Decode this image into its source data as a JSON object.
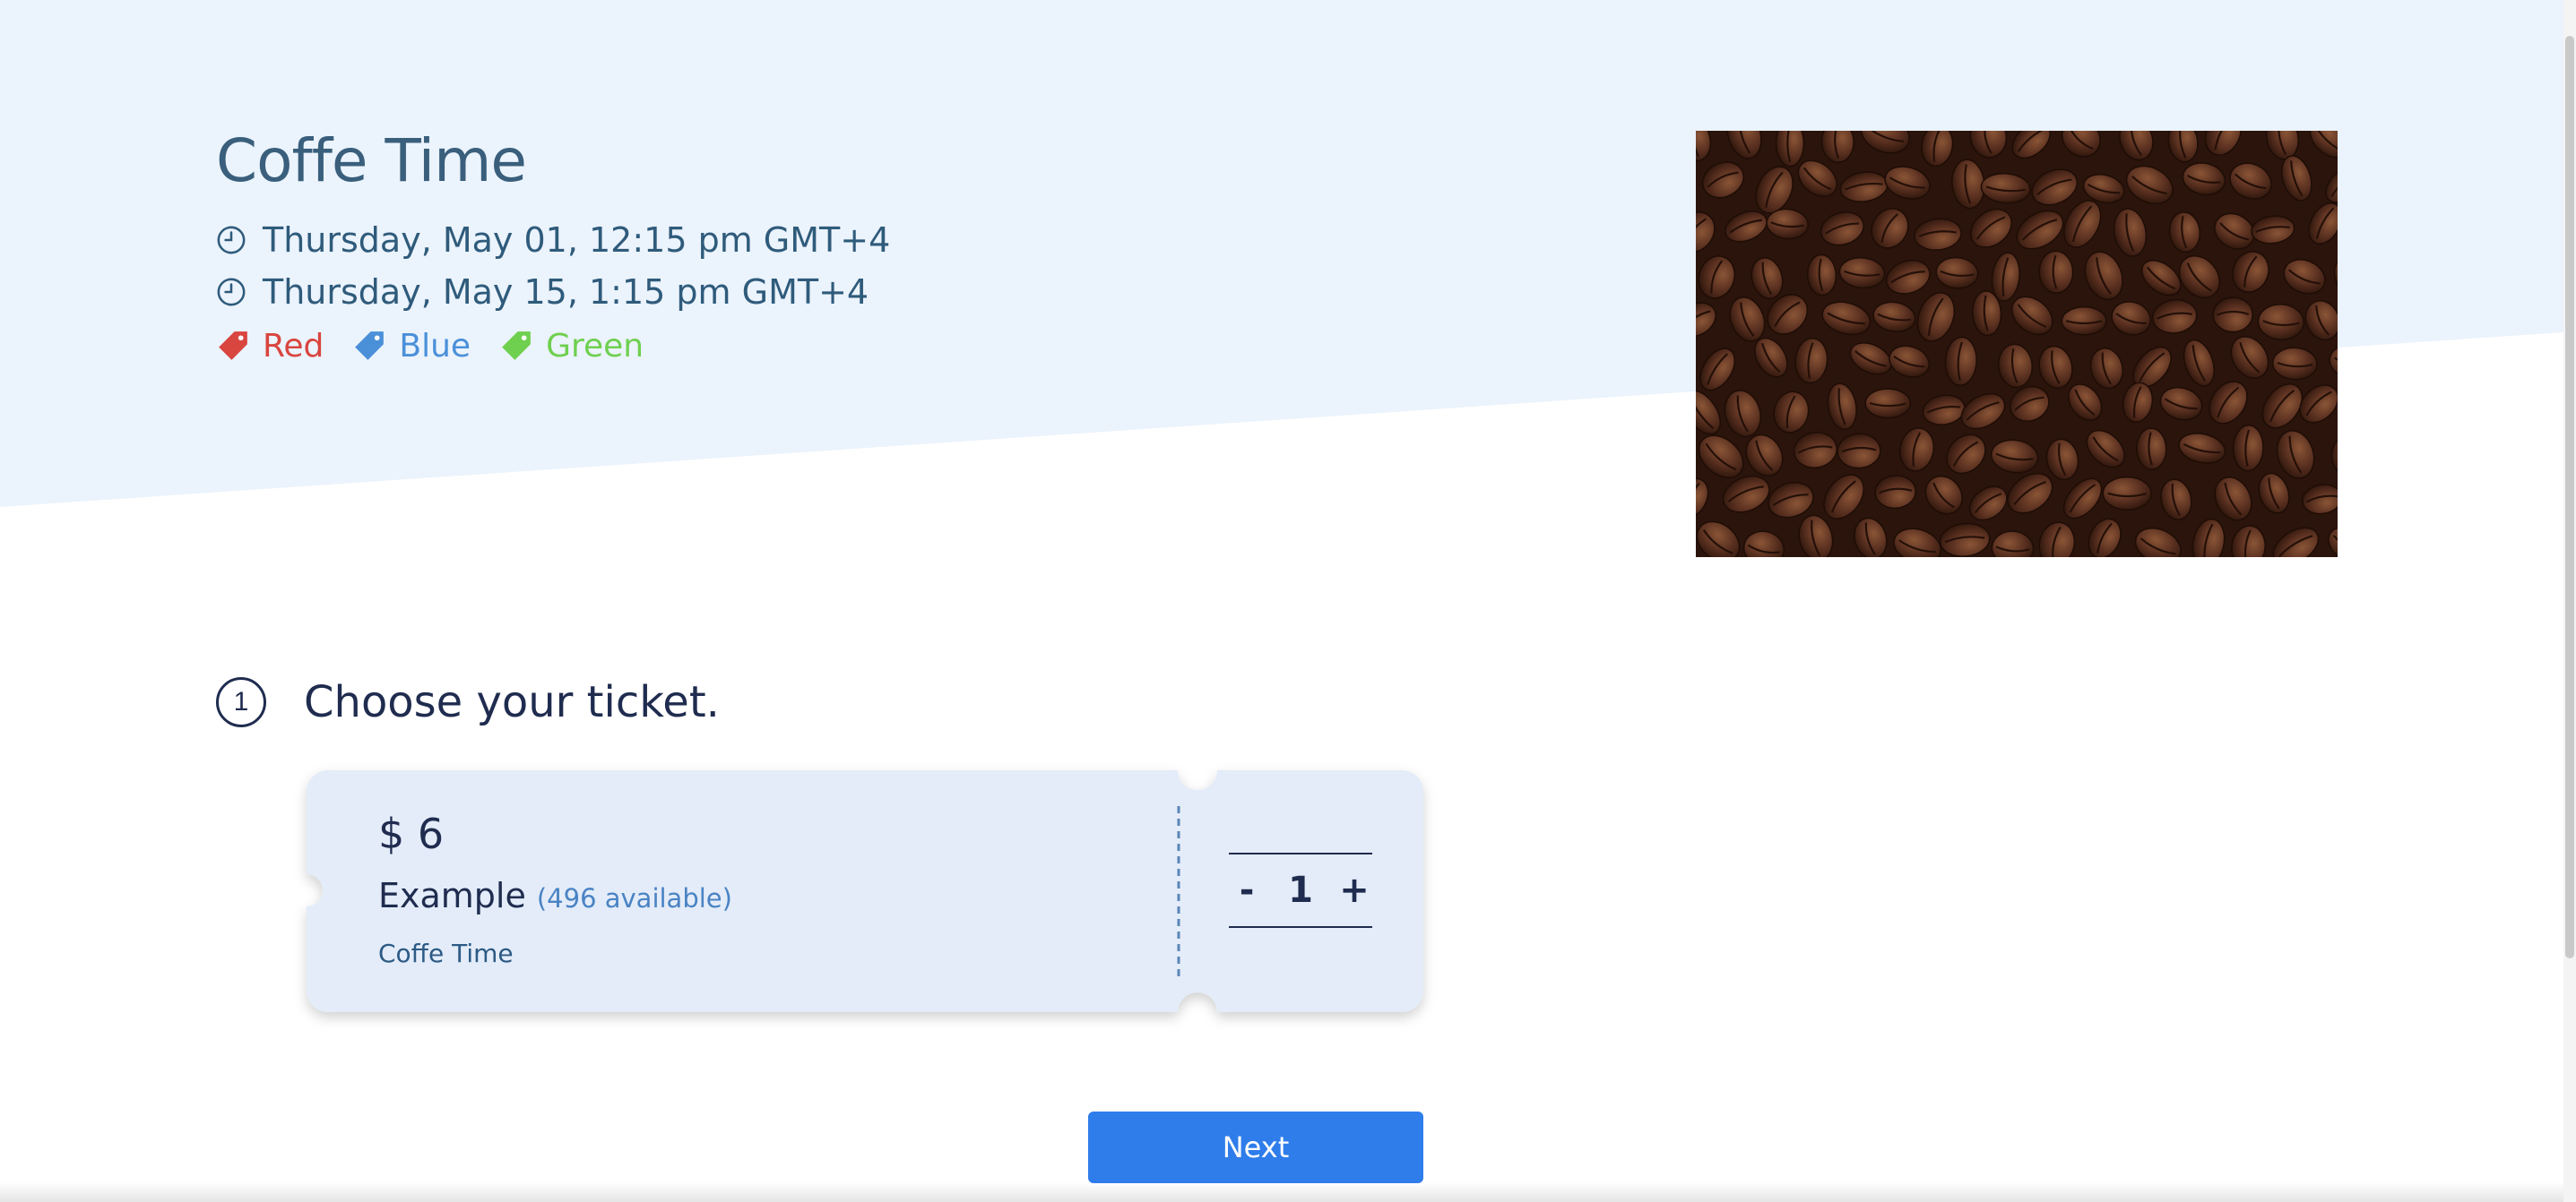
{
  "event": {
    "title": "Coffe Time",
    "start": "Thursday, May 01, 12:15 pm GMT+4",
    "end": "Thursday, May 15, 1:15 pm GMT+4",
    "tags": [
      {
        "label": "Red",
        "color": "#d9453f",
        "icon": "tag-icon"
      },
      {
        "label": "Blue",
        "color": "#4a90d9",
        "icon": "tag-icon"
      },
      {
        "label": "Green",
        "color": "#6fd04f",
        "icon": "tag-icon"
      }
    ],
    "image": {
      "subject": "coffee beans"
    }
  },
  "step": {
    "number": "1",
    "title": "Choose your ticket."
  },
  "ticket": {
    "price": "$ 6",
    "name": "Example",
    "availability": "(496 available)",
    "event_name": "Coffe Time",
    "quantity": "1",
    "minus_label": "-",
    "plus_label": "+"
  },
  "actions": {
    "next_label": "Next"
  },
  "colors": {
    "hero_background": "#ebf3fc",
    "ticket_background": "#e3ecf8",
    "accent": "#2f7deb",
    "heading": "#395f7c",
    "dark_text": "#1f2c4f"
  }
}
